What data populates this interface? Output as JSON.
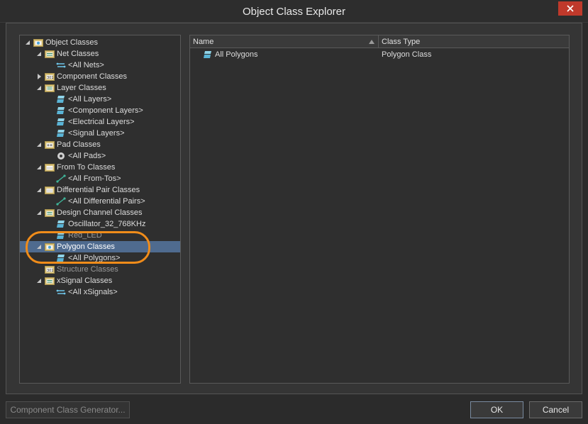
{
  "window": {
    "title": "Object Class Explorer"
  },
  "tree": [
    {
      "label": "Object Classes",
      "level": 0,
      "arrow": "expanded",
      "icon": "object-classes-icon",
      "name": "tree-object-classes"
    },
    {
      "label": "Net Classes",
      "level": 1,
      "arrow": "expanded",
      "icon": "net-classes-icon",
      "name": "tree-net-classes"
    },
    {
      "label": "<All Nets>",
      "level": 2,
      "arrow": "none",
      "icon": "net-icon",
      "name": "tree-all-nets"
    },
    {
      "label": "Component Classes",
      "level": 1,
      "arrow": "collapsed",
      "icon": "component-classes-icon",
      "name": "tree-component-classes"
    },
    {
      "label": "Layer Classes",
      "level": 1,
      "arrow": "expanded",
      "icon": "layer-classes-icon",
      "name": "tree-layer-classes"
    },
    {
      "label": "<All Layers>",
      "level": 2,
      "arrow": "none",
      "icon": "layer-icon",
      "name": "tree-all-layers"
    },
    {
      "label": "<Component Layers>",
      "level": 2,
      "arrow": "none",
      "icon": "layer-icon",
      "name": "tree-component-layers"
    },
    {
      "label": "<Electrical Layers>",
      "level": 2,
      "arrow": "none",
      "icon": "layer-icon",
      "name": "tree-electrical-layers"
    },
    {
      "label": "<Signal Layers>",
      "level": 2,
      "arrow": "none",
      "icon": "layer-icon",
      "name": "tree-signal-layers"
    },
    {
      "label": "Pad Classes",
      "level": 1,
      "arrow": "expanded",
      "icon": "pad-classes-icon",
      "name": "tree-pad-classes"
    },
    {
      "label": "<All Pads>",
      "level": 2,
      "arrow": "none",
      "icon": "pad-icon",
      "name": "tree-all-pads"
    },
    {
      "label": "From To Classes",
      "level": 1,
      "arrow": "expanded",
      "icon": "from-to-classes-icon",
      "name": "tree-from-to-classes"
    },
    {
      "label": "<All From-Tos>",
      "level": 2,
      "arrow": "none",
      "icon": "from-to-icon",
      "name": "tree-all-from-tos"
    },
    {
      "label": "Differential Pair Classes",
      "level": 1,
      "arrow": "expanded",
      "icon": "diff-pair-classes-icon",
      "name": "tree-differential-pair-classes"
    },
    {
      "label": "<All Differential Pairs>",
      "level": 2,
      "arrow": "none",
      "icon": "from-to-icon",
      "name": "tree-all-differential-pairs"
    },
    {
      "label": "Design Channel Classes",
      "level": 1,
      "arrow": "expanded",
      "icon": "design-channel-classes-icon",
      "name": "tree-design-channel-classes"
    },
    {
      "label": "Oscillator_32_768KHz",
      "level": 2,
      "arrow": "none",
      "icon": "layer-icon",
      "name": "tree-oscillator"
    },
    {
      "label": "Red_LED",
      "level": 2,
      "arrow": "none",
      "icon": "layer-icon",
      "name": "tree-red-led",
      "dim": true
    },
    {
      "label": "Polygon Classes",
      "level": 1,
      "arrow": "expanded",
      "icon": "polygon-classes-icon",
      "name": "tree-polygon-classes",
      "selected": true
    },
    {
      "label": "<All Polygons>",
      "level": 2,
      "arrow": "none",
      "icon": "polygon-icon",
      "name": "tree-all-polygons"
    },
    {
      "label": "Structure Classes",
      "level": 1,
      "arrow": "none",
      "icon": "structure-classes-icon",
      "name": "tree-structure-classes",
      "dim": true
    },
    {
      "label": "xSignal Classes",
      "level": 1,
      "arrow": "expanded",
      "icon": "xsignal-classes-icon",
      "name": "tree-xsignal-classes"
    },
    {
      "label": "<All xSignals>",
      "level": 2,
      "arrow": "none",
      "icon": "net-icon",
      "name": "tree-all-xsignals"
    }
  ],
  "list": {
    "columns": {
      "name": "Name",
      "type": "Class Type"
    },
    "rows": [
      {
        "name": "All Polygons",
        "type": "Polygon Class"
      }
    ]
  },
  "buttons": {
    "generator": "Component Class Generator...",
    "ok": "OK",
    "cancel": "Cancel"
  },
  "colors": {
    "selection": "#4f6b8f",
    "highlight": "#f08c1a",
    "close": "#c0392b"
  }
}
